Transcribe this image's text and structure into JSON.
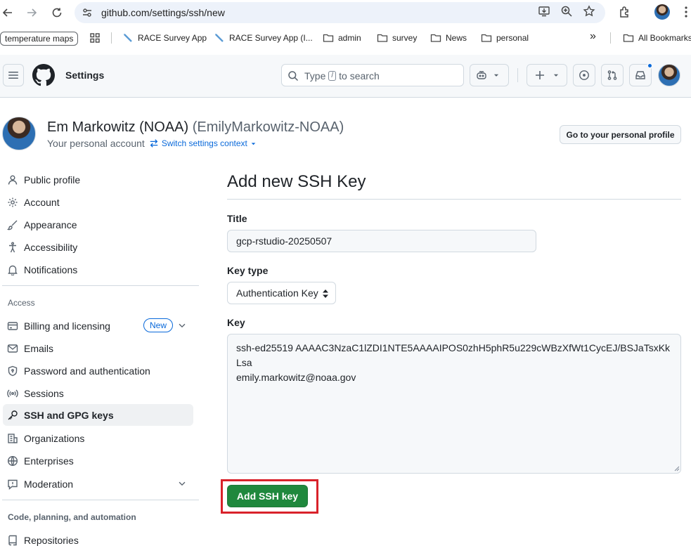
{
  "browser": {
    "url": "github.com/settings/ssh/new",
    "bookmarks": [
      {
        "label": "temperature maps",
        "type": "pill"
      },
      {
        "label": "RACE Survey App",
        "type": "link"
      },
      {
        "label": "RACE Survey App (I...",
        "type": "link"
      },
      {
        "label": "admin",
        "type": "folder"
      },
      {
        "label": "survey",
        "type": "folder"
      },
      {
        "label": "News",
        "type": "folder"
      },
      {
        "label": "personal",
        "type": "folder"
      },
      {
        "label": "All Bookmarks",
        "type": "folder"
      }
    ],
    "overflow_label": "»"
  },
  "header": {
    "title": "Settings",
    "search_prefix": "Type",
    "search_key": "/",
    "search_suffix": "to search"
  },
  "context": {
    "name": "Em Markowitz (NOAA)",
    "login": "(EmilyMarkowitz-NOAA)",
    "subtitle": "Your personal account",
    "switch_label": "Switch settings context",
    "profile_button": "Go to your personal profile"
  },
  "sidebar": {
    "items": [
      {
        "label": "Public profile",
        "icon": "person-icon"
      },
      {
        "label": "Account",
        "icon": "gear-icon"
      },
      {
        "label": "Appearance",
        "icon": "paintbrush-icon"
      },
      {
        "label": "Accessibility",
        "icon": "accessibility-icon"
      },
      {
        "label": "Notifications",
        "icon": "bell-icon"
      }
    ],
    "access_heading": "Access",
    "access_items": [
      {
        "label": "Billing and licensing",
        "icon": "credit-card-icon",
        "badge": "New"
      },
      {
        "label": "Emails",
        "icon": "mail-icon"
      },
      {
        "label": "Password and authentication",
        "icon": "shield-lock-icon"
      },
      {
        "label": "Sessions",
        "icon": "broadcast-icon"
      },
      {
        "label": "SSH and GPG keys",
        "icon": "key-icon",
        "active": true
      },
      {
        "label": "Organizations",
        "icon": "organization-icon"
      },
      {
        "label": "Enterprises",
        "icon": "globe-icon"
      },
      {
        "label": "Moderation",
        "icon": "report-icon"
      }
    ],
    "code_heading": "Code, planning, and automation",
    "code_items": [
      {
        "label": "Repositories",
        "icon": "repo-icon"
      }
    ]
  },
  "form": {
    "heading": "Add new SSH Key",
    "title_label": "Title",
    "title_value": "gcp-rstudio-20250507",
    "key_type_label": "Key type",
    "key_type_value": "Authentication Key",
    "key_label": "Key",
    "key_value": "ssh-ed25519 AAAAC3NzaC1lZDI1NTE5AAAAIPOS0zhH5phR5u229cWBzXfWt1CycEJ/BSJaTsxKkLsa\nemily.markowitz@noaa.gov",
    "submit_label": "Add SSH key"
  },
  "colors": {
    "primary_button": "#1f883d",
    "link": "#0969da",
    "highlight": "#d9222a",
    "border": "#d1d9e0"
  }
}
